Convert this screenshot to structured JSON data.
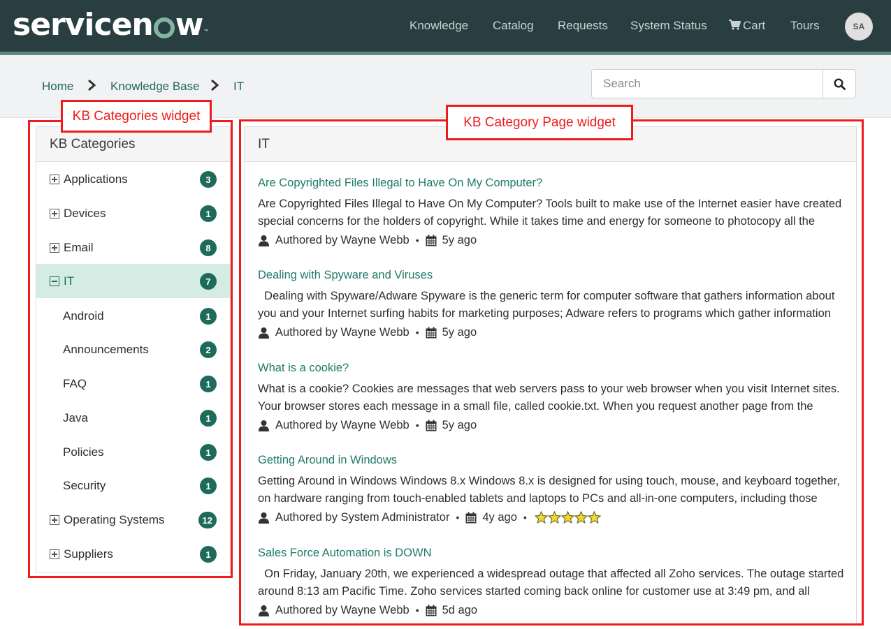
{
  "header": {
    "logo_text": "servicenow",
    "nav": [
      "Knowledge",
      "Catalog",
      "Requests",
      "System Status",
      "Cart",
      "Tours"
    ],
    "avatar_initials": "SA",
    "colors": {
      "bar": "#293e40",
      "accent": "#81b5a1",
      "link": "#1f6a55",
      "badge": "#1e6b5b"
    }
  },
  "breadcrumb": [
    "Home",
    "Knowledge Base",
    "IT"
  ],
  "search": {
    "placeholder": "Search",
    "value": ""
  },
  "annotations": {
    "left": "KB Categories widget",
    "right": "KB Category Page widget"
  },
  "categories": {
    "title": "KB Categories",
    "items": [
      {
        "label": "Applications",
        "count": "3",
        "toggle": "plus",
        "level": 0
      },
      {
        "label": "Devices",
        "count": "1",
        "toggle": "plus",
        "level": 0
      },
      {
        "label": "Email",
        "count": "8",
        "toggle": "plus",
        "level": 0
      },
      {
        "label": "IT",
        "count": "7",
        "toggle": "minus",
        "level": 0,
        "active": true
      },
      {
        "label": "Android",
        "count": "1",
        "level": 1
      },
      {
        "label": "Announcements",
        "count": "2",
        "level": 1
      },
      {
        "label": "FAQ",
        "count": "1",
        "level": 1
      },
      {
        "label": "Java",
        "count": "1",
        "level": 1
      },
      {
        "label": "Policies",
        "count": "1",
        "level": 1
      },
      {
        "label": "Security",
        "count": "1",
        "level": 1
      },
      {
        "label": "Operating Systems",
        "count": "12",
        "toggle": "plus",
        "level": 0
      },
      {
        "label": "Suppliers",
        "count": "1",
        "toggle": "plus",
        "level": 0
      }
    ]
  },
  "category_page": {
    "title": "IT",
    "articles": [
      {
        "title": "Are Copyrighted Files Illegal to Have On My Computer?",
        "snippet": "Are Copyrighted Files Illegal to Have On My Computer? Tools built to make use of the Internet easier have created special concerns for the holders of copyright. While it takes time and energy for someone to photocopy all the",
        "author": "Authored by Wayne Webb",
        "age": "5y ago"
      },
      {
        "title": "Dealing with Spyware and Viruses",
        "snippet": "  Dealing with Spyware/Adware Spyware is the generic term for computer software that gathers information about you and your Internet surfing habits for marketing purposes; Adware refers to programs which gather information",
        "author": "Authored by Wayne Webb",
        "age": "5y ago"
      },
      {
        "title": "What is a cookie?",
        "snippet": "What is a cookie? Cookies are messages that web servers pass to your web browser when you visit Internet sites. Your browser stores each message in a small file, called cookie.txt. When you request another page from the server,",
        "author": "Authored by Wayne Webb",
        "age": "5y ago"
      },
      {
        "title": "Getting Around in Windows",
        "snippet": "Getting Around in Windows Windows 8.x Windows 8.x is designed for using touch, mouse, and keyboard together, on hardware ranging from touch-enabled tablets and laptops to PCs and all-in-one computers, including those",
        "author": "Authored by System Administrator",
        "age": "4y ago",
        "rating": 5
      },
      {
        "title": "Sales Force Automation is DOWN",
        "snippet": "  On Friday, January 20th, we experienced a widespread outage that affected all Zoho services. The outage started around 8:13 am Pacific Time. Zoho services started coming back online for customer use at 3:49 pm, and all",
        "author": "Authored by Wayne Webb",
        "age": "5d ago"
      }
    ]
  }
}
